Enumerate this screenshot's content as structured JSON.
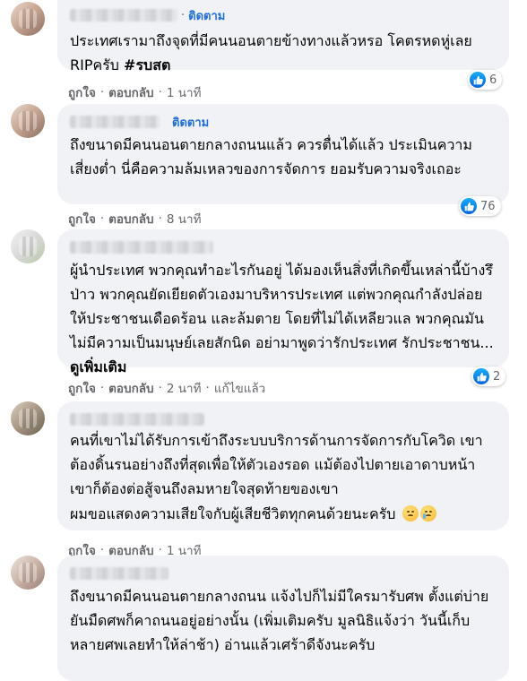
{
  "comments": [
    {
      "follow_label": "ติดตาม",
      "text": "ประเทศเรามาถึงจุดที่มีคนนอนตายข้างทางแล้วหรอ โคตรหดหู่เลย RIPครับ",
      "hashtag": "#รบสต",
      "actions": {
        "like": "ถูกใจ",
        "reply": "ตอบกลับ",
        "time": "1 นาที"
      },
      "reaction_count": "6"
    },
    {
      "follow_label": "ติดตาม",
      "text": "ถึงขนาดมีคนนอนตายกลางถนนแล้ว ควรตื่นได้แล้ว ประเมินความเสี่ยงต่ำ นี่คือความล้มเหลวของการจัดการ ยอมรับความจริงเถอะ",
      "actions": {
        "like": "ถูกใจ",
        "reply": "ตอบกลับ",
        "time": "8 นาที"
      },
      "reaction_count": "76"
    },
    {
      "text": "ผู้นำประเทศ พวกคุณทำอะไรกันอยู่ ได้มองเห็นสิ่งที่เกิดขึ้นเหล่านี้บ้างรึป่าว พวกคุณยัดเยียดตัวเองมาบริหารประเทศ แต่พวกคุณกำลังปล่อยให้ประชาชนเดือดร้อน และล้มตาย โดยที่ไม่ได้เหลียวแล พวกคุณมันไม่มีความเป็นมนุษย์เลยสักนิด อย่ามาพูดว่ารักประเทศ รักประชาชน...",
      "see_more": "ดูเพิ่มเติม",
      "actions": {
        "like": "ถูกใจ",
        "reply": "ตอบกลับ",
        "time": "2 นาที",
        "edited": "แก้ไขแล้ว"
      },
      "reaction_count": "2"
    },
    {
      "text": "คนที่เขาไม่ได้รับการเข้าถึงระบบบริการด้านการจัดการกับโควิด เขาต้องดิ้นรนอย่างถึงที่สุดเพื่อให้ตัวเองรอด แม้ต้องไปตายเอาดาบหน้า เขาก็ต้องต่อสู้จนถึงลมหายใจสุดท้ายของเขา",
      "text2": "ผมขอแสดงความเสียใจกับผู้เสียชีวิตทุกคนด้วยนะครับ",
      "actions": {
        "like": "ถูกใจ",
        "reply": "ตอบกลับ",
        "time": "1 นาที"
      }
    },
    {
      "text": "ถึงขนาดมีคนนอนตายกลางถนน แจ้งไปก็ไม่มีใครมารับศพ ตั้งแต่บ่ายยันมืดศพก็คาถนนอยู่อย่างนั้น (เพิ่มเติมครับ มูลนิธิแจ้งว่า วันนี้เก็บหลายศพเลยทำให้ล่าช้า) อ่านแล้วเศร้าดีจังนะครับ"
    }
  ],
  "colors": {
    "bubble": "#f0f2f5",
    "follow": "#216fdb",
    "meta": "#65676b",
    "like": "#0062df"
  }
}
